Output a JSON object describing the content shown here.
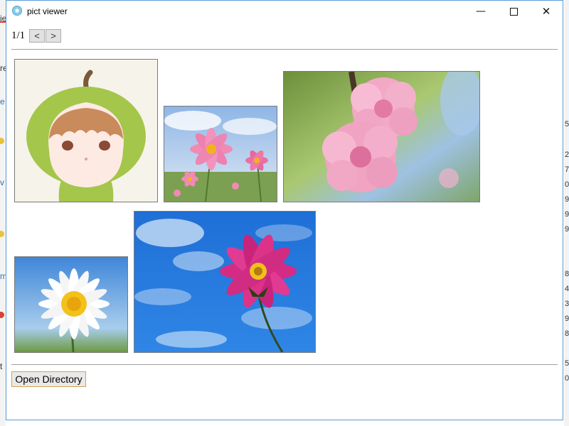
{
  "window": {
    "title": "pict viewer",
    "controls": {
      "minimize": "—",
      "close": "✕"
    }
  },
  "nav": {
    "page_indicator": "1/1",
    "prev_label": "<",
    "next_label": ">"
  },
  "thumbnails": [
    {
      "name": "cartoon-character",
      "subject": "character"
    },
    {
      "name": "pink-cosmos-field",
      "subject": "flower"
    },
    {
      "name": "peach-blossoms",
      "subject": "flower"
    },
    {
      "name": "white-daisy",
      "subject": "flower"
    },
    {
      "name": "magenta-cosmos-sky",
      "subject": "flower"
    }
  ],
  "actions": {
    "open_directory_label": "Open Directory"
  },
  "background_app": {
    "left_fragments": [
      "ie",
      "re",
      "e",
      "v",
      "m",
      "t"
    ],
    "right_fragments": [
      "5",
      "2",
      "7",
      "0",
      "9",
      "9",
      "9",
      "8",
      "4",
      "3",
      "9",
      "8",
      "5",
      "0"
    ]
  },
  "colors": {
    "window_border": "#5a9bd5",
    "button_face": "#e1e1e1",
    "separator": "#a0a0a0",
    "focus_border": "#d4a24c"
  }
}
